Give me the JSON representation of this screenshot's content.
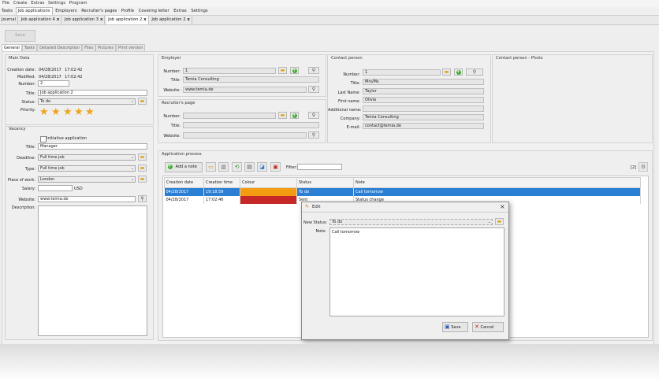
{
  "menu": [
    "File",
    "Create",
    "Extras",
    "Settings",
    "Program"
  ],
  "nav": [
    "Tasks",
    "Job applications",
    "Employers",
    "Recruiter's pages",
    "Profile",
    "Covering letter",
    "Extras",
    "Settings"
  ],
  "nav_active": "Job applications",
  "doc_tabs": [
    {
      "label": "Journal",
      "close": ""
    },
    {
      "label": "Job application 4",
      "close": "x"
    },
    {
      "label": "Job application 3",
      "close": "x"
    },
    {
      "label": "Job application 2",
      "close": "x"
    },
    {
      "label": "Job application 2",
      "close": "x"
    }
  ],
  "toolbar": {
    "save_label": "Save"
  },
  "subtabs": [
    "General",
    "Tasks",
    "Detailed Description",
    "Files",
    "Pictures",
    "Print version"
  ],
  "main_data": {
    "title": "Main Data",
    "creation_date_label": "Creation date:",
    "creation_date": "04/28/2017",
    "creation_time": "17:02:42",
    "modified_label": "Modified:",
    "modified_date": "04/28/2017",
    "modified_time": "17:02:42",
    "number_label": "Number:",
    "number": "2",
    "title_label": "Title:",
    "title_value": "Job application 2",
    "status_label": "Status:",
    "status": "To do",
    "priority_label": "Priority:",
    "priority_stars": 5
  },
  "vacancy": {
    "title": "Vacancy",
    "initiative_label": "Initiative application",
    "initiative_checked": false,
    "title_label": "Title:",
    "title_value": "Manager",
    "deadline_label": "Deadline:",
    "deadline": "Full time job",
    "type_label": "Type:",
    "type": "Full time job",
    "place_label": "Place of work:",
    "place": "London",
    "salary_label": "Salary:",
    "salary": "",
    "currency": "USD",
    "website_label": "Website:",
    "website": "www.temia.de",
    "description_label": "Description:"
  },
  "employer": {
    "title": "Employer",
    "number_label": "Number:",
    "number": "1",
    "title_label": "Title:",
    "title_value": "Temia Consulting",
    "website_label": "Website:",
    "website": "www.temia.de"
  },
  "recruiter": {
    "title": "Recruiter's page",
    "number_label": "Number:",
    "title_label": "Title:",
    "website_label": "Website:"
  },
  "contact": {
    "title": "Contact person",
    "number_label": "Number:",
    "number": "1",
    "title_label": "Title:",
    "title_value": "Mrs/Ms",
    "lastname_label": "Last Name:",
    "lastname": "Taylor",
    "firstname_label": "First name:",
    "firstname": "Olivia",
    "additional_label": "Additional name:",
    "additional": "",
    "company_label": "Company:",
    "company": "Temia Consulting",
    "email_label": "E-mail:",
    "email": "contact@temia.de"
  },
  "photo": {
    "title": "Contact person - Photo"
  },
  "process": {
    "title": "Application process",
    "add_note_label": "Add a note",
    "filter_label": "Filter:",
    "count": "[2]",
    "columns": [
      "Creation date",
      "Creation time",
      "Colour",
      "Status",
      "Note"
    ],
    "rows": [
      {
        "date": "04/28/2017",
        "time": "19:18:59",
        "colour": "#f39c12",
        "status": "To do",
        "note": "Call tomorrow"
      },
      {
        "date": "04/28/2017",
        "time": "17:02:46",
        "colour": "#c62828",
        "status": "Sent",
        "note": "Status change"
      }
    ]
  },
  "dialog": {
    "title": "Edit",
    "close": "×",
    "status_label": "New Status:",
    "status_value": "To do",
    "note_label": "Note:",
    "note_value": "Call tomorrow",
    "save_label": "Save",
    "cancel_label": "Cancel"
  },
  "colors": {
    "accent": "#2a7fd4",
    "star": "#f0a31a",
    "plus": "#3cae2c",
    "folder": "#d9a200"
  }
}
